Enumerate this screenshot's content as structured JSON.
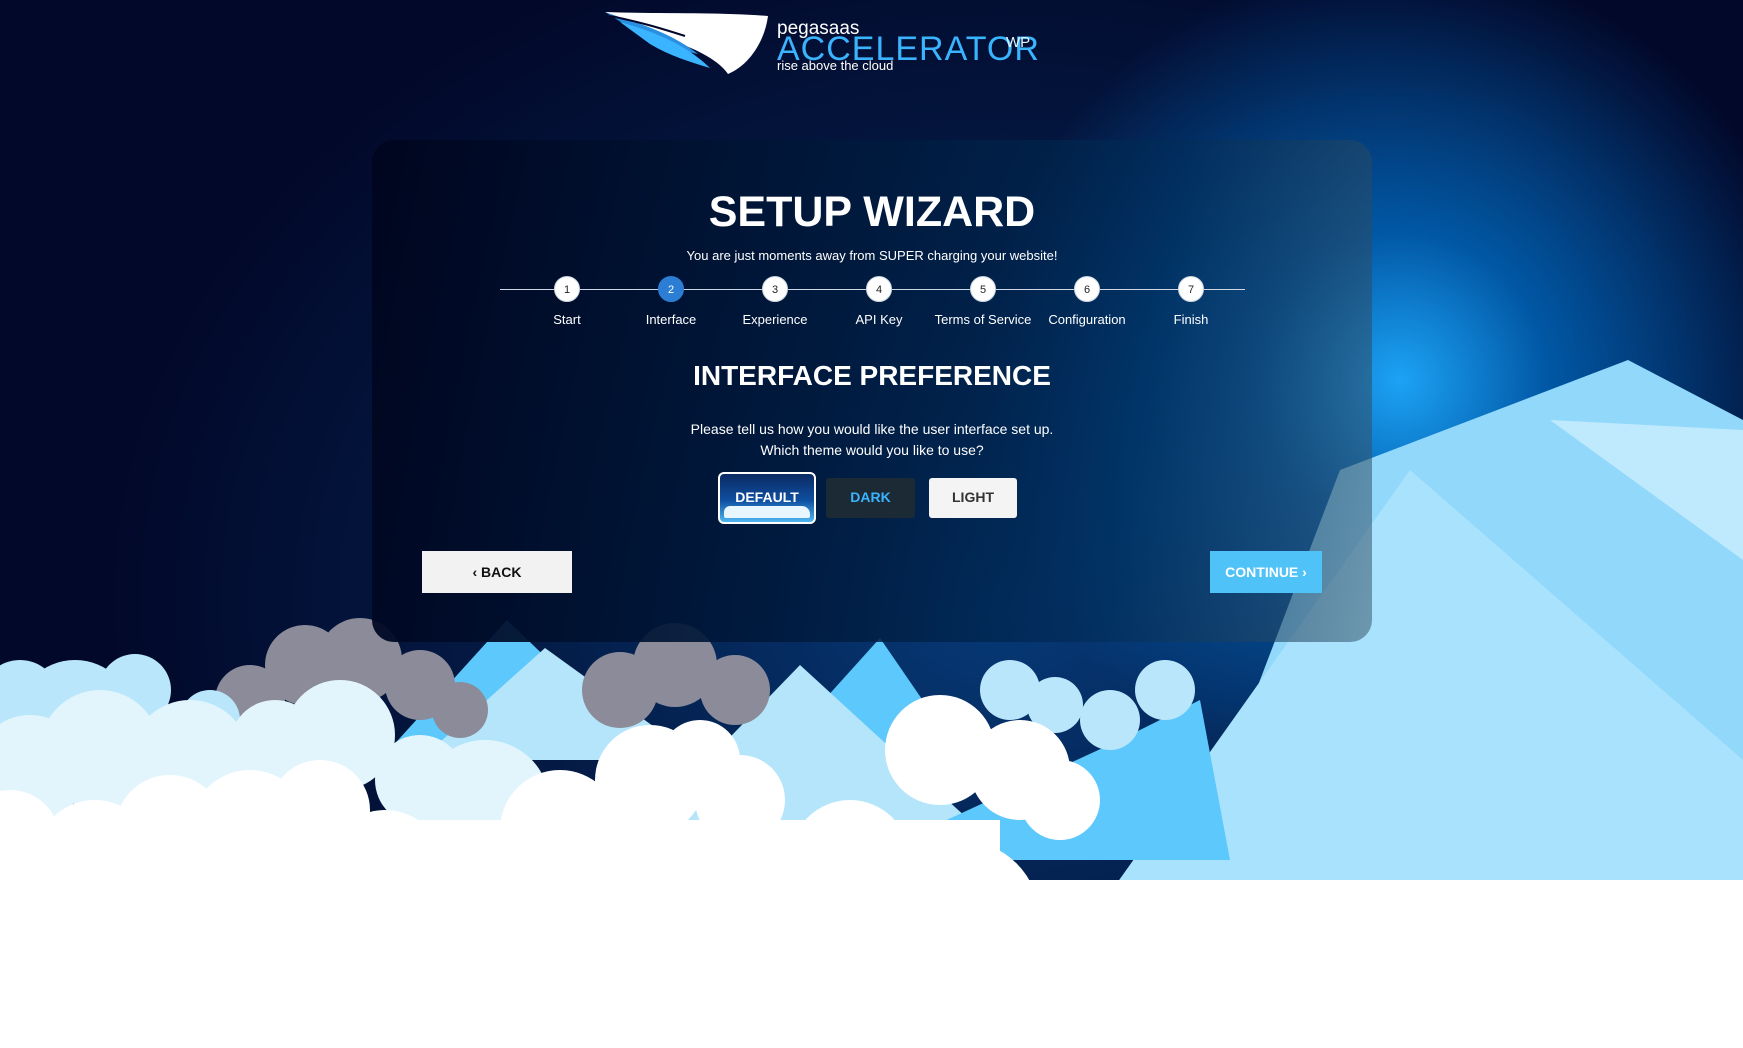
{
  "logo": {
    "brand_small": "pegasaas",
    "brand_big": "ACCELERATOR",
    "tagline": "rise above the cloud",
    "edition": "WP"
  },
  "wizard": {
    "title": "SETUP WIZARD",
    "subtitle": "You are just moments away from SUPER charging your website!",
    "active_step": 2,
    "steps": [
      {
        "number": "1",
        "label": "Start"
      },
      {
        "number": "2",
        "label": "Interface"
      },
      {
        "number": "3",
        "label": "Experience"
      },
      {
        "number": "4",
        "label": "API Key"
      },
      {
        "number": "5",
        "label": "Terms of Service"
      },
      {
        "number": "6",
        "label": "Configuration"
      },
      {
        "number": "7",
        "label": "Finish"
      }
    ]
  },
  "interface": {
    "heading": "INTERFACE PREFERENCE",
    "line1": "Please tell us how you would like the user interface set up.",
    "line2": "Which theme would you like to use?",
    "themes": {
      "default": "DEFAULT",
      "dark": "DARK",
      "light": "LIGHT"
    },
    "selected_theme": "DEFAULT"
  },
  "nav": {
    "back": "‹ BACK",
    "continue": "CONTINUE ›"
  },
  "colors": {
    "accent": "#3ab4ff",
    "active_step": "#2b7ed4",
    "continue_button": "#4fc2f7",
    "sky_top": "#02072a"
  }
}
